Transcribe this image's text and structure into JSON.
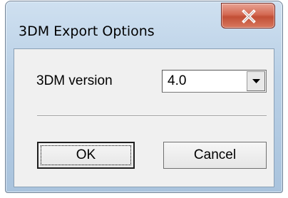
{
  "window": {
    "title": "3DM Export Options",
    "close_icon": "close-icon"
  },
  "form": {
    "version_label": "3DM version",
    "version_value": "4.0",
    "dropdown_icon": "chevron-down-icon"
  },
  "buttons": {
    "ok_label": "OK",
    "cancel_label": "Cancel"
  },
  "colors": {
    "close_button": "#c24f36",
    "frame": "#b9d0e6",
    "client": "#f0f0f0"
  }
}
